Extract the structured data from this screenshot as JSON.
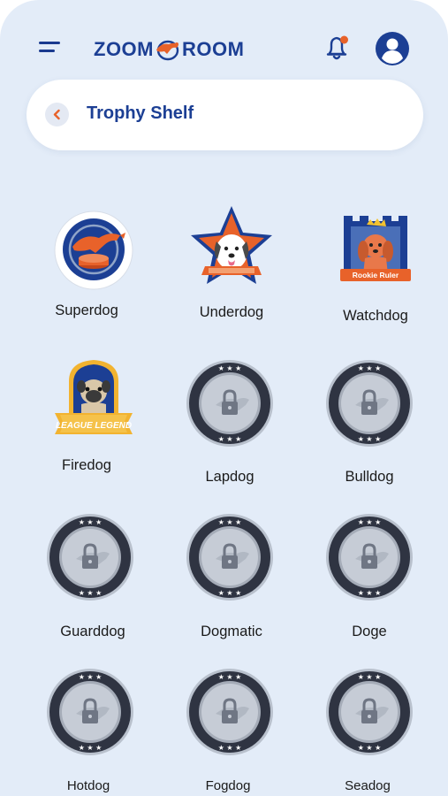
{
  "header": {
    "logo_left": "ZOOM",
    "logo_right": "ROOM",
    "menu_icon": "hamburger-menu-icon",
    "notification_icon": "bell-icon",
    "profile_icon": "user-avatar-icon"
  },
  "page": {
    "title": "Trophy Shelf",
    "back_icon": "chevron-left-icon"
  },
  "colors": {
    "brand_blue": "#1c3f94",
    "accent_orange": "#e8622a",
    "background": "#e3ecf8",
    "locked_ring": "#2f3442"
  },
  "trophies": [
    {
      "name": "Superdog",
      "state": "unlocked",
      "badge_text": ""
    },
    {
      "name": "Underdog",
      "state": "unlocked",
      "badge_text": ""
    },
    {
      "name": "Watchdog",
      "state": "unlocked",
      "badge_text": "Rookie Ruler"
    },
    {
      "name": "Firedog",
      "state": "unlocked",
      "badge_text": "LEAGUE LEGEND"
    },
    {
      "name": "Lapdog",
      "state": "locked",
      "badge_text": ""
    },
    {
      "name": "Bulldog",
      "state": "locked",
      "badge_text": ""
    },
    {
      "name": "Guarddog",
      "state": "locked",
      "badge_text": ""
    },
    {
      "name": "Dogmatic",
      "state": "locked",
      "badge_text": ""
    },
    {
      "name": "Doge",
      "state": "locked",
      "badge_text": ""
    },
    {
      "name": "Hotdog",
      "state": "locked",
      "badge_text": ""
    },
    {
      "name": "Fogdog",
      "state": "locked",
      "badge_text": ""
    },
    {
      "name": "Seadog",
      "state": "locked",
      "badge_text": ""
    }
  ]
}
